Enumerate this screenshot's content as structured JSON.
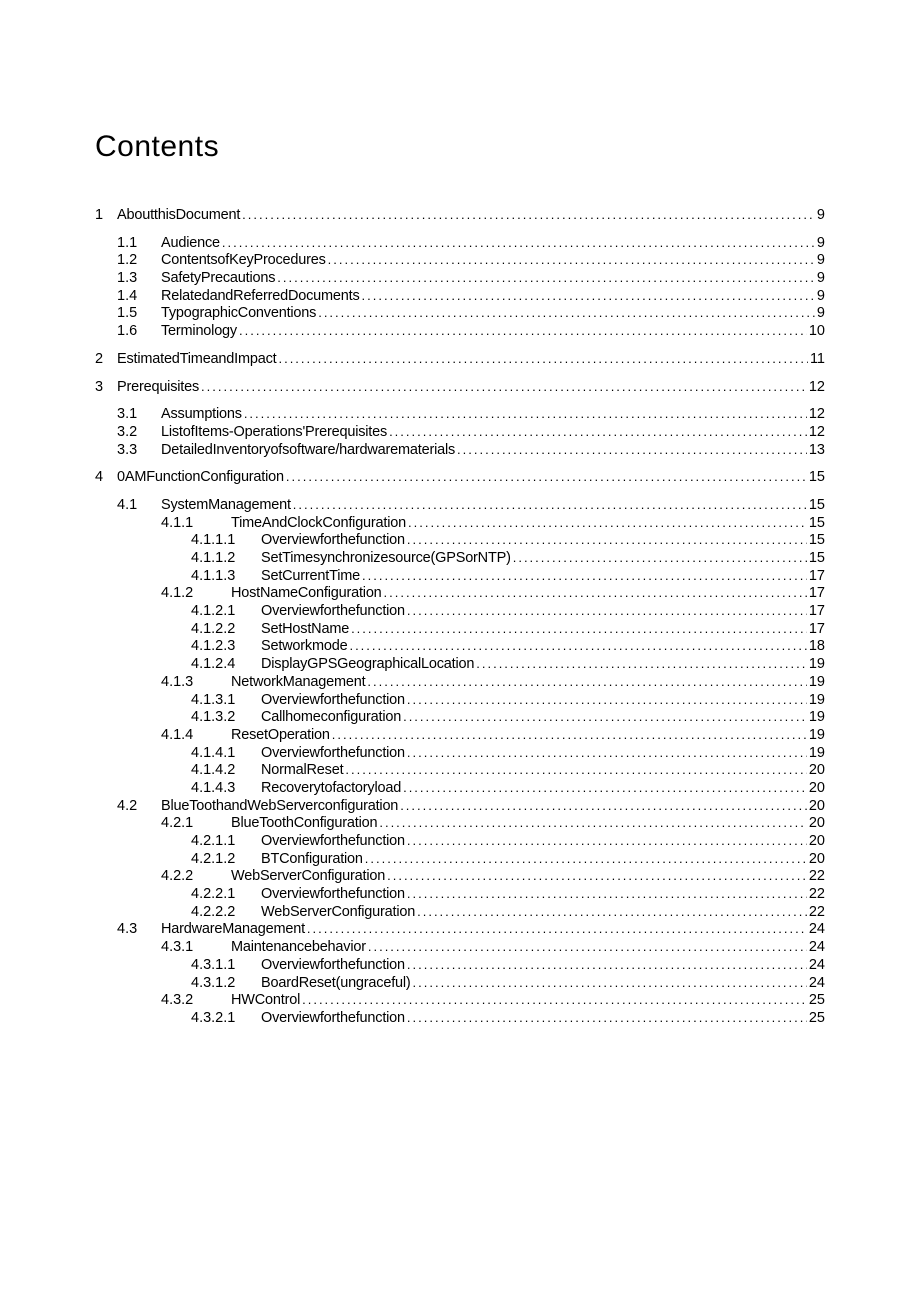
{
  "title": "Contents",
  "toc": [
    {
      "level": 0,
      "num": "1",
      "label": "AboutthisDocument",
      "page": "9",
      "gap_before": false
    },
    {
      "level": 1,
      "num": "1.1",
      "label": "Audience",
      "page": "9",
      "gap_before": true
    },
    {
      "level": 1,
      "num": "1.2",
      "label": "ContentsofKeyProcedures",
      "page": "9",
      "gap_before": false
    },
    {
      "level": 1,
      "num": "1.3",
      "label": "SafetyPrecautions",
      "page": "9",
      "gap_before": false
    },
    {
      "level": 1,
      "num": "1.4",
      "label": "RelatedandReferredDocuments",
      "page": "9",
      "gap_before": false
    },
    {
      "level": 1,
      "num": "1.5",
      "label": "TypographicConventions",
      "page": "9",
      "gap_before": false
    },
    {
      "level": 1,
      "num": "1.6",
      "label": "Terminology",
      "page": "10",
      "gap_before": false
    },
    {
      "level": 0,
      "num": "2",
      "label": "EstimatedTimeandImpact",
      "page": "11",
      "gap_before": true
    },
    {
      "level": 0,
      "num": "3",
      "label": "Prerequisites",
      "page": "12",
      "gap_before": true
    },
    {
      "level": 1,
      "num": "3.1",
      "label": "Assumptions",
      "page": "12",
      "gap_before": true
    },
    {
      "level": 1,
      "num": "3.2",
      "label": "ListofItems-Operations'Prerequisites",
      "page": "12",
      "gap_before": false
    },
    {
      "level": 1,
      "num": "3.3",
      "label": "DetailedInventoryofsoftware/hardwarematerials",
      "page": "13",
      "gap_before": false
    },
    {
      "level": 0,
      "num": "4",
      "label": "0AMFunctionConfiguration",
      "page": "15",
      "gap_before": true
    },
    {
      "level": 1,
      "num": "4.1",
      "label": "SystemManagement",
      "page": "15",
      "gap_before": true
    },
    {
      "level": 2,
      "num": "4.1.1",
      "label": "TimeAndClockConfiguration",
      "page": "15",
      "gap_before": false
    },
    {
      "level": 3,
      "num": "4.1.1.1",
      "label": "Overviewforthefunction",
      "page": "15",
      "gap_before": false
    },
    {
      "level": 3,
      "num": "4.1.1.2",
      "label": "SetTimesynchronizesource(GPSorNTP)",
      "page": "15",
      "gap_before": false
    },
    {
      "level": 3,
      "num": "4.1.1.3",
      "label": "SetCurrentTime",
      "page": "17",
      "gap_before": false
    },
    {
      "level": 2,
      "num": "4.1.2",
      "label": "HostNameConfiguration",
      "page": "17",
      "gap_before": false
    },
    {
      "level": 3,
      "num": "4.1.2.1",
      "label": "Overviewforthefunction",
      "page": "17",
      "gap_before": false
    },
    {
      "level": 3,
      "num": "4.1.2.2",
      "label": "SetHostName",
      "page": "17",
      "gap_before": false
    },
    {
      "level": 3,
      "num": "4.1.2.3",
      "label": "Setworkmode",
      "page": "18",
      "gap_before": false
    },
    {
      "level": 3,
      "num": "4.1.2.4",
      "label": "DisplayGPSGeographicalLocation",
      "page": "19",
      "gap_before": false
    },
    {
      "level": 2,
      "num": "4.1.3",
      "label": "NetworkManagement",
      "page": "19",
      "gap_before": false
    },
    {
      "level": 3,
      "num": "4.1.3.1",
      "label": "Overviewforthefunction",
      "page": "19",
      "gap_before": false
    },
    {
      "level": 3,
      "num": "4.1.3.2",
      "label": "Callhomeconfiguration",
      "page": "19",
      "gap_before": false
    },
    {
      "level": 2,
      "num": "4.1.4",
      "label": "ResetOperation",
      "page": "19",
      "gap_before": false
    },
    {
      "level": 3,
      "num": "4.1.4.1",
      "label": "Overviewforthefunction",
      "page": "19",
      "gap_before": false
    },
    {
      "level": 3,
      "num": "4.1.4.2",
      "label": "NormalReset",
      "page": "20",
      "gap_before": false
    },
    {
      "level": 3,
      "num": "4.1.4.3",
      "label": "Recoverytofactoryload",
      "page": "20",
      "gap_before": false
    },
    {
      "level": 1,
      "num": "4.2",
      "label": "BlueToothandWebServerconfiguration",
      "page": "20",
      "gap_before": false
    },
    {
      "level": 2,
      "num": "4.2.1",
      "label": "BlueToothConfiguration",
      "page": "20",
      "gap_before": false
    },
    {
      "level": 3,
      "num": "4.2.1.1",
      "label": "Overviewforthefunction",
      "page": "20",
      "gap_before": false
    },
    {
      "level": 3,
      "num": "4.2.1.2",
      "label": "BTConfiguration",
      "page": "20",
      "gap_before": false
    },
    {
      "level": 2,
      "num": "4.2.2",
      "label": "WebServerConfiguration",
      "page": "22",
      "gap_before": false
    },
    {
      "level": 3,
      "num": "4.2.2.1",
      "label": "Overviewforthefunction",
      "page": "22",
      "gap_before": false
    },
    {
      "level": 3,
      "num": "4.2.2.2",
      "label": "WebServerConfiguration",
      "page": "22",
      "gap_before": false
    },
    {
      "level": 1,
      "num": "4.3",
      "label": "HardwareManagement",
      "page": "24",
      "gap_before": false
    },
    {
      "level": 2,
      "num": "4.3.1",
      "label": "Maintenancebehavior",
      "page": "24",
      "gap_before": false
    },
    {
      "level": 3,
      "num": "4.3.1.1",
      "label": "Overviewforthefunction",
      "page": "24",
      "gap_before": false
    },
    {
      "level": 3,
      "num": "4.3.1.2",
      "label": "BoardReset(ungraceful)",
      "page": "24",
      "gap_before": false
    },
    {
      "level": 2,
      "num": "4.3.2",
      "label": "HWControl",
      "page": "25",
      "gap_before": false
    },
    {
      "level": 3,
      "num": "4.3.2.1",
      "label": "Overviewforthefunction",
      "page": "25",
      "gap_before": false
    }
  ]
}
